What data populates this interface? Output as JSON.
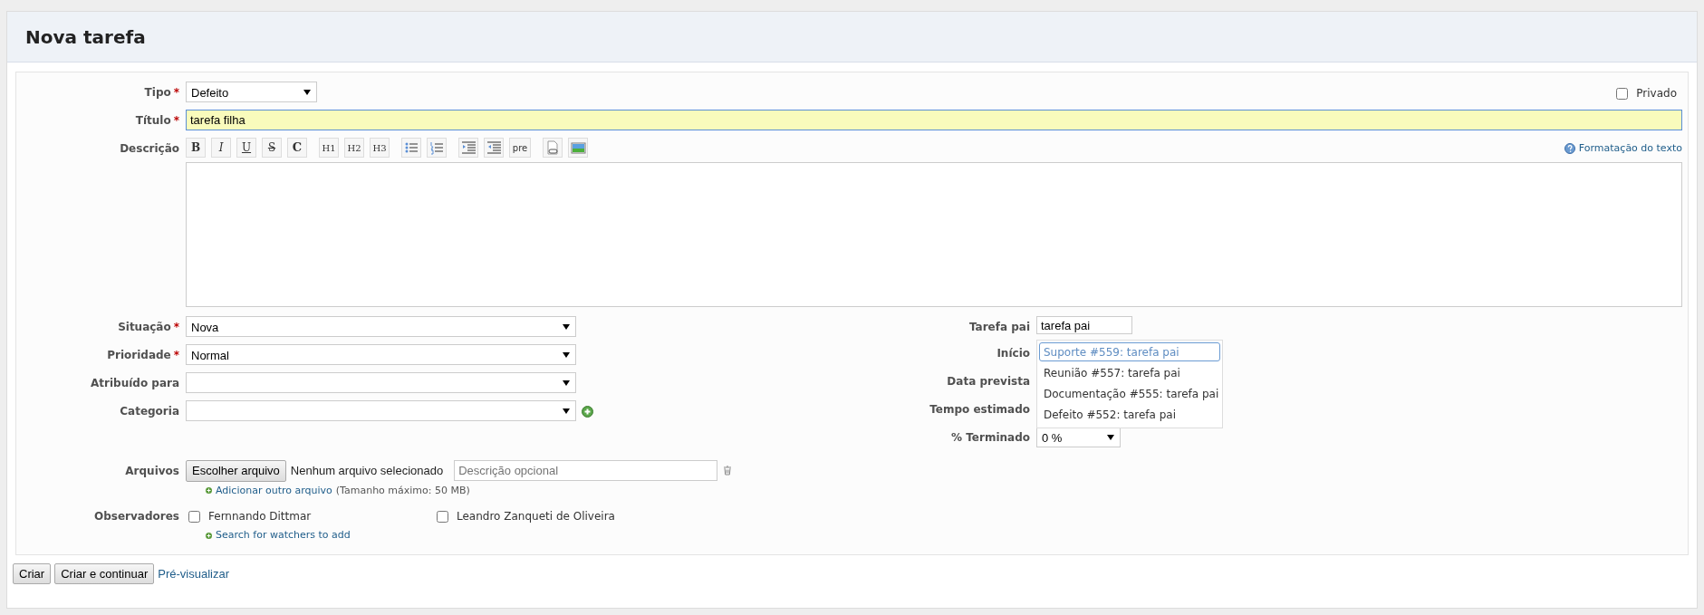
{
  "title": "Nova tarefa",
  "tipo": {
    "label": "Tipo",
    "required_mark": "*",
    "value": "Defeito"
  },
  "privado": {
    "label": "Privado",
    "checked": false
  },
  "titulo": {
    "label": "Título",
    "required_mark": "*",
    "value": "tarefa filha"
  },
  "descricao": {
    "label": "Descrição",
    "help_link": "Formatação do texto",
    "toolbar_groups": [
      [
        {
          "kind": "bold",
          "text": "B"
        },
        {
          "kind": "italic",
          "text": "I"
        },
        {
          "kind": "underline",
          "text": "U"
        },
        {
          "kind": "strike",
          "text": "S"
        },
        {
          "kind": "code",
          "text": "C"
        }
      ],
      [
        {
          "kind": "heading",
          "text": "H1"
        },
        {
          "kind": "heading",
          "text": "H2"
        },
        {
          "kind": "heading",
          "text": "H3"
        }
      ],
      [
        {
          "kind": "bullets"
        },
        {
          "kind": "numbers"
        }
      ],
      [
        {
          "kind": "indent"
        },
        {
          "kind": "outdent"
        },
        {
          "kind": "pre",
          "text": "pre"
        }
      ],
      [
        {
          "kind": "link"
        },
        {
          "kind": "image"
        }
      ]
    ]
  },
  "left_fields": [
    {
      "label": "Situação",
      "required_mark": "*",
      "value": "Nova"
    },
    {
      "label": "Prioridade",
      "required_mark": "*",
      "value": "Normal"
    },
    {
      "label": "Atribuído para"
    },
    {
      "label": "Categoria",
      "add_button": true
    }
  ],
  "right_fields": [
    {
      "kind": "text",
      "label": "Tarefa pai",
      "value": "tarefa pai"
    },
    {
      "kind": "covered",
      "label": "Início"
    },
    {
      "kind": "covered",
      "label": "Data prevista"
    },
    {
      "kind": "covered",
      "label": "Tempo estimado"
    },
    {
      "kind": "select",
      "label": "% Terminado",
      "value": "0 %"
    }
  ],
  "autocomplete": [
    {
      "text": "Suporte #559: tarefa pai",
      "selected": true
    },
    {
      "text": "Reunião #557: tarefa pai",
      "selected": false
    },
    {
      "text": "Documentação #555: tarefa pai",
      "selected": false
    },
    {
      "text": "Defeito #552: tarefa pai",
      "selected": false
    }
  ],
  "arquivos": {
    "label": "Arquivos",
    "button": "Escolher arquivo",
    "status": "Nenhum arquivo selecionado",
    "placeholder": "Descrição opcional",
    "add_link": "Adicionar outro arquivo",
    "add_note": "(Tamanho máximo: 50 MB)"
  },
  "observadores": {
    "label": "Observadores",
    "watchers": [
      {
        "name": "Fernnando Dittmar",
        "checked": false
      },
      {
        "name": "Leandro Zanqueti de Oliveira",
        "checked": false
      }
    ],
    "search_link": "Search for watchers to add"
  },
  "actions": {
    "buttons": [
      "Criar",
      "Criar e continuar"
    ],
    "preview_link": "Pré-visualizar"
  }
}
